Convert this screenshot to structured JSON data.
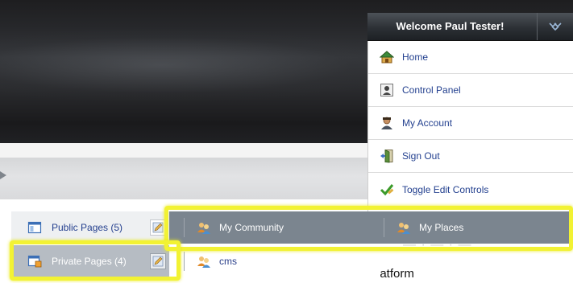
{
  "dock": {
    "welcome": "Welcome Paul Tester!",
    "toggle_icon": "double-chevron-icon",
    "items": [
      {
        "label": "Home",
        "icon": "home-icon"
      },
      {
        "label": "Control Panel",
        "icon": "control-panel-icon"
      },
      {
        "label": "My Account",
        "icon": "user-account-icon"
      },
      {
        "label": "Sign Out",
        "icon": "exit-door-icon"
      },
      {
        "label": "Toggle Edit Controls",
        "icon": "check-pencil-icon"
      }
    ]
  },
  "nav": {
    "public_pages": "Public Pages (5)",
    "private_pages": "Private Pages (4)",
    "sites": [
      {
        "label": "My Community",
        "icon": "community-icon"
      },
      {
        "label": "My Places",
        "icon": "places-icon"
      },
      {
        "label": "cms",
        "icon": "community-icon"
      }
    ]
  },
  "background": {
    "platform_text": "Platform"
  },
  "colors": {
    "highlight": "#f2f233",
    "link": "#23408f",
    "site_bar": "#7b858f"
  }
}
